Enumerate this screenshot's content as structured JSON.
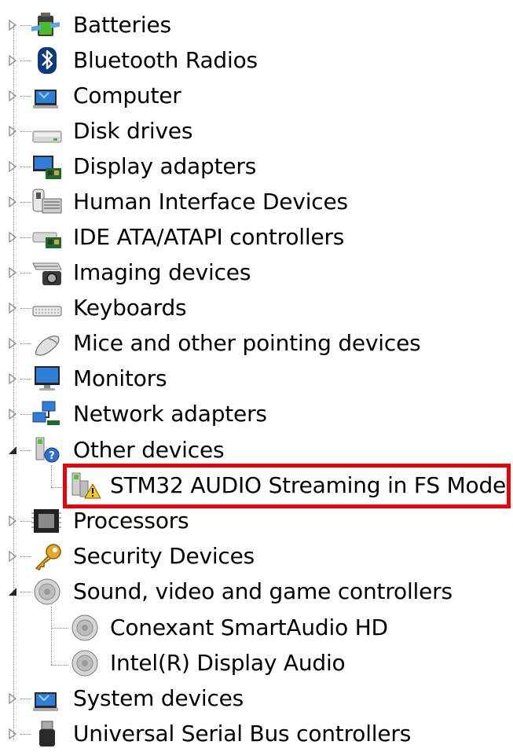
{
  "tree": {
    "items": [
      {
        "label": "Batteries",
        "icon": "battery-icon",
        "state": "collapsed"
      },
      {
        "label": "Bluetooth Radios",
        "icon": "bluetooth-icon",
        "state": "collapsed"
      },
      {
        "label": "Computer",
        "icon": "computer-icon",
        "state": "collapsed"
      },
      {
        "label": "Disk drives",
        "icon": "disk-drive-icon",
        "state": "collapsed"
      },
      {
        "label": "Display adapters",
        "icon": "display-adapter-icon",
        "state": "collapsed"
      },
      {
        "label": "Human Interface Devices",
        "icon": "hid-icon",
        "state": "collapsed"
      },
      {
        "label": "IDE ATA/ATAPI controllers",
        "icon": "ide-controller-icon",
        "state": "collapsed"
      },
      {
        "label": "Imaging devices",
        "icon": "camera-icon",
        "state": "collapsed"
      },
      {
        "label": "Keyboards",
        "icon": "keyboard-icon",
        "state": "collapsed"
      },
      {
        "label": "Mice and other pointing devices",
        "icon": "mouse-icon",
        "state": "collapsed"
      },
      {
        "label": "Monitors",
        "icon": "monitor-icon",
        "state": "collapsed"
      },
      {
        "label": "Network adapters",
        "icon": "network-icon",
        "state": "collapsed"
      },
      {
        "label": "Other devices",
        "icon": "unknown-device-icon",
        "state": "expanded",
        "children": [
          {
            "label": "STM32 AUDIO Streaming in FS Mode",
            "icon": "warning-device-icon"
          }
        ]
      },
      {
        "label": "Processors",
        "icon": "processor-icon",
        "state": "collapsed"
      },
      {
        "label": "Security Devices",
        "icon": "key-icon",
        "state": "collapsed"
      },
      {
        "label": "Sound, video and game controllers",
        "icon": "speaker-icon",
        "state": "expanded",
        "children": [
          {
            "label": "Conexant SmartAudio HD",
            "icon": "speaker-icon"
          },
          {
            "label": "Intel(R) Display Audio",
            "icon": "speaker-icon"
          }
        ]
      },
      {
        "label": "System devices",
        "icon": "system-icon",
        "state": "collapsed"
      },
      {
        "label": "Universal Serial Bus controllers",
        "icon": "usb-icon",
        "state": "collapsed"
      }
    ]
  },
  "colors": {
    "highlight_border": "#e8000b",
    "tree_line": "#8a8a8a"
  }
}
